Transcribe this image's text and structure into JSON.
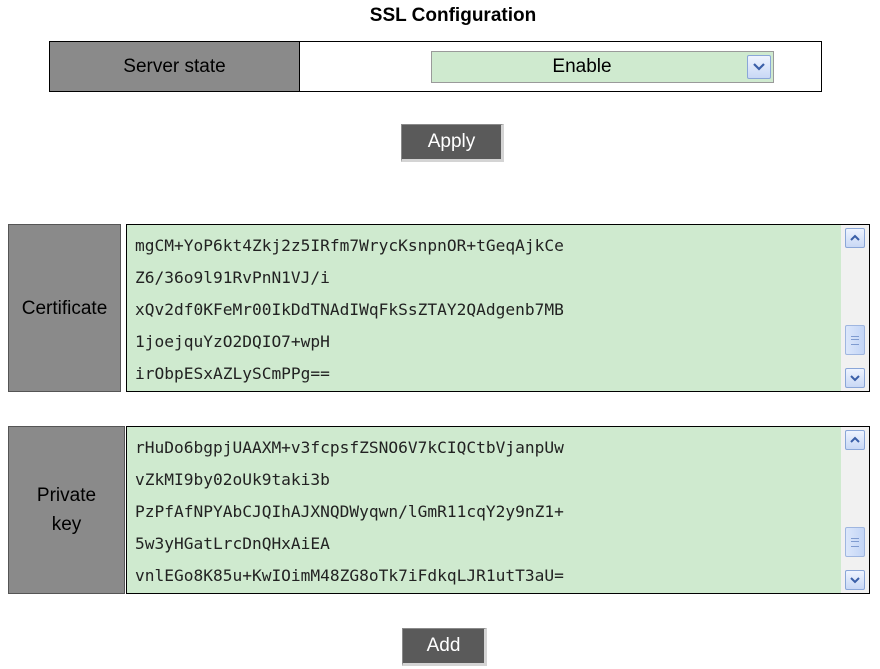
{
  "page": {
    "title": "SSL Configuration"
  },
  "server_state": {
    "label": "Server state",
    "selected": "Enable",
    "options": [
      "Enable"
    ]
  },
  "buttons": {
    "apply": "Apply",
    "add": "Add"
  },
  "certificate": {
    "label": "Certificate",
    "text": "mgCM+YoP6kt4Zkj2z5IRfm7WrycKsnpnOR+tGeqAjkCe\nZ6/36o9l91RvPnN1VJ/i\nxQv2df0KFeMr00IkDdTNAdIWqFkSsZTAY2QAdgenb7MB\n1joejquYzO2DQIO7+wpH\nirObpESxAZLySCmPPg=="
  },
  "private_key": {
    "label": "Private key",
    "text": "rHuDo6bgpjUAAXM+v3fcpsfZSNO6V7kCIQCtbVjanpUw\nvZkMI9by02oUk9taki3b\nPzPfAfNPYAbCJQIhAJXNQDWyqwn/lGmR11cqY2y9nZ1+\n5w3yHGatLrcDnQHxAiEA\nvnlEGo8K85u+KwIOimM48ZG8oTk7iFdkqLJR1utT3aU="
  }
}
